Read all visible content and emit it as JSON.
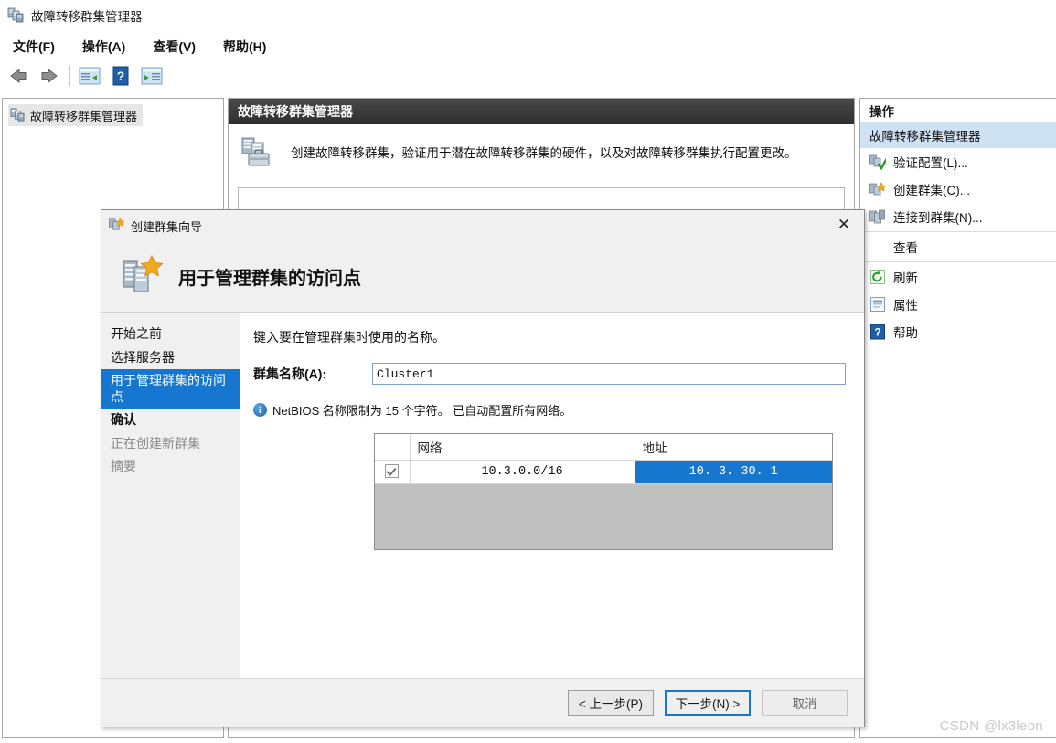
{
  "window": {
    "title": "故障转移群集管理器",
    "title_icon": "cluster-icon"
  },
  "menubar": {
    "items": [
      {
        "label": "文件(F)",
        "name": "menu-file"
      },
      {
        "label": "操作(A)",
        "name": "menu-action"
      },
      {
        "label": "查看(V)",
        "name": "menu-view"
      },
      {
        "label": "帮助(H)",
        "name": "menu-help"
      }
    ]
  },
  "toolbar": {
    "items": [
      {
        "icon": "back-arrow-icon",
        "label": ""
      },
      {
        "icon": "forward-arrow-icon",
        "label": ""
      },
      {
        "icon": "show-hide-tree-icon",
        "label": ""
      },
      {
        "icon": "help-icon",
        "label": ""
      },
      {
        "icon": "show-hide-action-pane-icon",
        "label": ""
      }
    ]
  },
  "tree": {
    "root_label": "故障转移群集管理器"
  },
  "center": {
    "header": "故障转移群集管理器",
    "description": "创建故障转移群集，验证用于潜在故障转移群集的硬件，以及对故障转移群集执行配置更改。"
  },
  "actions": {
    "header": "操作",
    "selected": "故障转移群集管理器",
    "items": [
      {
        "label": "验证配置(L)...",
        "icon": "validate-config-icon",
        "name": "action-validate-config"
      },
      {
        "label": "创建群集(C)...",
        "icon": "create-cluster-icon",
        "name": "action-create-cluster"
      },
      {
        "label": "连接到群集(N)...",
        "icon": "connect-cluster-icon",
        "name": "action-connect-cluster"
      },
      {
        "label": "查看",
        "icon": "",
        "name": "action-view"
      },
      {
        "label": "刷新",
        "icon": "refresh-icon",
        "name": "action-refresh"
      },
      {
        "label": "属性",
        "icon": "properties-icon",
        "name": "action-properties"
      },
      {
        "label": "帮助",
        "icon": "help-icon",
        "name": "action-help"
      }
    ]
  },
  "wizard": {
    "title": "创建群集向导",
    "close_label": "✕",
    "banner_title": "用于管理群集的访问点",
    "nav": [
      {
        "label": "开始之前",
        "state": "normal"
      },
      {
        "label": "选择服务器",
        "state": "normal"
      },
      {
        "label": "用于管理群集的访问点",
        "state": "active"
      },
      {
        "label": "确认",
        "state": "bold"
      },
      {
        "label": "正在创建新群集",
        "state": "dim"
      },
      {
        "label": "摘要",
        "state": "dim"
      }
    ],
    "prompt": "键入要在管理群集时使用的名称。",
    "cluster_name_label": "群集名称(A):",
    "cluster_name_value": "Cluster1",
    "cluster_name_placeholder": "",
    "note": "NetBIOS 名称限制为 15 个字符。 已自动配置所有网络。",
    "table": {
      "columns": [
        "",
        "网络",
        "地址"
      ],
      "rows": [
        {
          "checked": true,
          "network": "10.3.0.0/16",
          "address": "10. 3. 30. 1",
          "address_selected": true
        }
      ]
    },
    "buttons": {
      "previous": "< 上一步(P)",
      "next": "下一步(N) >",
      "cancel": "取消"
    }
  },
  "watermark": "CSDN @lx3leon",
  "colors": {
    "accent_blue": "#1577cf",
    "header_dark": "#3a3a3a",
    "action_selected": "#cfe2f3",
    "banner_blue": "#0b4285"
  }
}
